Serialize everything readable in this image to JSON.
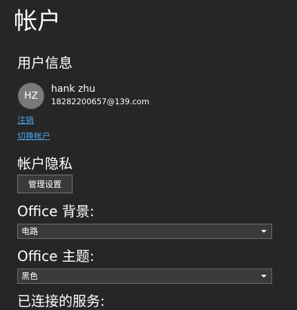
{
  "page": {
    "title": "帐户"
  },
  "user_info": {
    "heading": "用户信息",
    "avatar_initials": "HZ",
    "name": "hank zhu",
    "email": "18282200657@139.com",
    "sign_out_link": "注销",
    "switch_account_link": "切换帐户"
  },
  "privacy": {
    "heading": "帐户隐私",
    "manage_button": "管理设置"
  },
  "background": {
    "heading": "Office 背景:",
    "selected": "电路"
  },
  "theme": {
    "heading": "Office 主题:",
    "selected": "黑色"
  },
  "connected_services": {
    "heading": "已连接的服务:"
  },
  "colors": {
    "background": "#262626",
    "link": "#4aa3e6",
    "avatar": "#7a7a7a"
  }
}
